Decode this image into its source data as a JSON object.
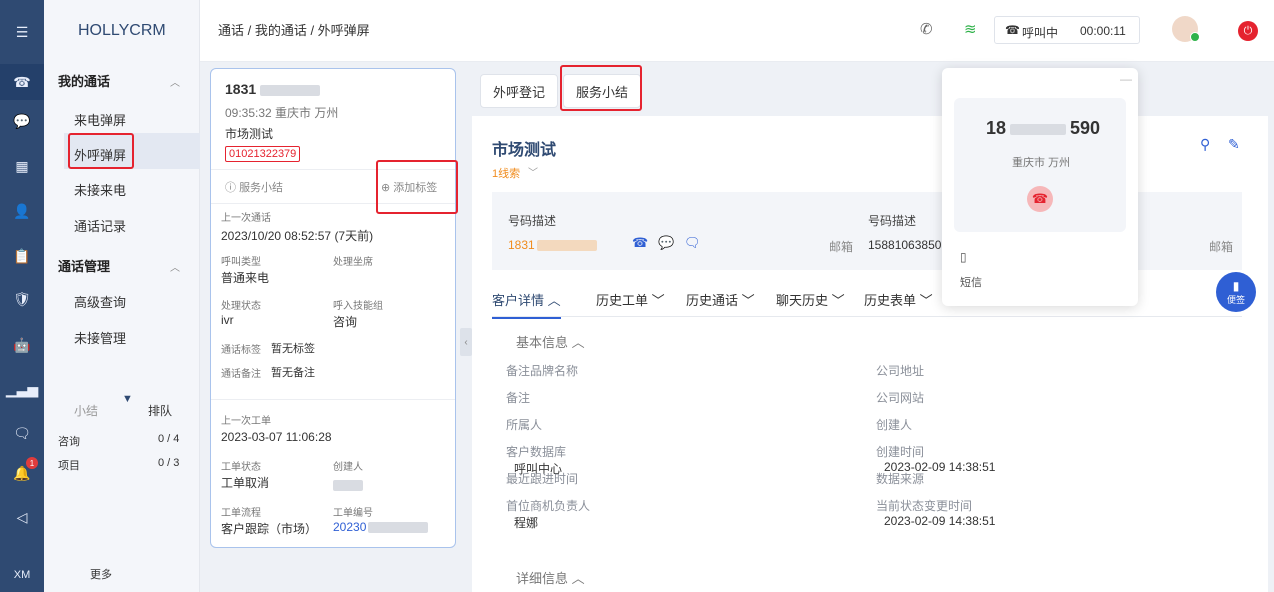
{
  "rail": {
    "logo": "XM"
  },
  "sidebar": {
    "brand": "HOLLYCRM",
    "section1": "我的通话",
    "items1": [
      "来电弹屏",
      "外呼弹屏",
      "未接来电",
      "通话记录"
    ],
    "section2": "通话管理",
    "items2": [
      "高级查询",
      "未接管理"
    ],
    "queue_tabs": [
      "小结",
      "排队"
    ],
    "queue_rows": [
      {
        "name": "咨询",
        "count": "0 / 4"
      },
      {
        "name": "项目",
        "count": "0 / 3"
      }
    ],
    "more": "更多"
  },
  "header": {
    "breadcrumb": "通话 / 我的通话 / 外呼弹屏",
    "status": "呼叫中",
    "timer": "00:00:11"
  },
  "card": {
    "phone": "1831",
    "time_place": "09:35:32 重庆市 万州",
    "name": "市场测试",
    "tag": "01021322379",
    "service_summary": "服务小结",
    "add_tag": "添加标签",
    "last_call_label": "上一次通话",
    "last_call_time": "2023/10/20 08:52:57 (7天前)",
    "call_type_label": "呼叫类型",
    "agent_label": "处理坐席",
    "call_type": "普通来电",
    "status_label": "处理状态",
    "skill_label": "呼入技能组",
    "status": "ivr",
    "skill": "咨询",
    "tag_label": "通话标签",
    "tag_value": "暂无标签",
    "note_label": "通话备注",
    "note_value": "暂无备注",
    "last_ticket_label": "上一次工单",
    "last_ticket_time": "2023-03-07 11:06:28",
    "ticket_status_label": "工单状态",
    "creator_label": "创建人",
    "ticket_status": "工单取消",
    "flow_label": "工单流程",
    "ticket_no_label": "工单编号",
    "flow": "客户跟踪（市场）",
    "ticket_no": "20230"
  },
  "tabs": [
    "外呼登记",
    "服务小结"
  ],
  "customer": {
    "name": "市场测试",
    "sub": "1线索",
    "num_desc_label": "号码描述",
    "num_desc_label2": "号码描述",
    "phone1": "1831",
    "email_label": "邮箱",
    "phone2": "15881063850",
    "email_label2": "邮箱"
  },
  "detail_tabs": [
    "客户详情",
    "历史工单",
    "历史通话",
    "聊天历史",
    "历史表单"
  ],
  "basic": {
    "title": "基本信息",
    "left": [
      {
        "k": "备注品牌名称",
        "v": ""
      },
      {
        "k": "备注",
        "v": ""
      },
      {
        "k": "所属人",
        "v": ""
      },
      {
        "k": "客户数据库",
        "v": "呼叫中心"
      },
      {
        "k": "最近跟进时间",
        "v": ""
      },
      {
        "k": "首位商机负责人",
        "v": "程娜"
      }
    ],
    "right": [
      {
        "k": "公司地址",
        "v": ""
      },
      {
        "k": "公司网站",
        "v": ""
      },
      {
        "k": "创建人",
        "v": ""
      },
      {
        "k": "创建时间",
        "v": "2023-02-09 14:38:51"
      },
      {
        "k": "数据来源",
        "v": ""
      },
      {
        "k": "当前状态变更时间",
        "v": "2023-02-09 14:38:51"
      }
    ],
    "detail_title": "详细信息"
  },
  "popup": {
    "number_left": "18",
    "number_right": "590",
    "location": "重庆市 万州",
    "sms": "短信"
  },
  "float_btn": "便签",
  "colors": {
    "brand": "#2f4a72",
    "accent": "#2f5fd4",
    "highlight": "#e5232f",
    "link": "#f08c1e"
  }
}
